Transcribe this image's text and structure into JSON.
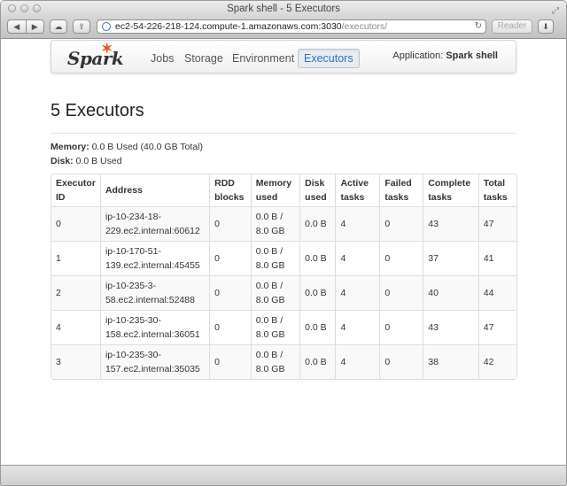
{
  "window": {
    "title": "Spark shell - 5 Executors",
    "url_host": "ec2-54-226-218-124.compute-1.amazonaws.com:3030",
    "url_path": "/executors/",
    "reader_label": "Reader"
  },
  "nav": {
    "logo_text": "Spark",
    "items": [
      {
        "label": "Jobs"
      },
      {
        "label": "Storage"
      },
      {
        "label": "Environment"
      },
      {
        "label": "Executors"
      }
    ],
    "app_label": "Application:",
    "app_name": "Spark shell"
  },
  "page": {
    "heading": "5 Executors",
    "memory_label": "Memory:",
    "memory_value": "0.0 B Used (40.0 GB Total)",
    "disk_label": "Disk:",
    "disk_value": "0.0 B Used"
  },
  "table": {
    "headers": [
      "Executor ID",
      "Address",
      "RDD blocks",
      "Memory used",
      "Disk used",
      "Active tasks",
      "Failed tasks",
      "Complete tasks",
      "Total tasks"
    ],
    "rows": [
      [
        "0",
        "ip-10-234-18-229.ec2.internal:60612",
        "0",
        "0.0 B / 8.0 GB",
        "0.0 B",
        "4",
        "0",
        "43",
        "47"
      ],
      [
        "1",
        "ip-10-170-51-139.ec2.internal:45455",
        "0",
        "0.0 B / 8.0 GB",
        "0.0 B",
        "4",
        "0",
        "37",
        "41"
      ],
      [
        "2",
        "ip-10-235-3-58.ec2.internal:52488",
        "0",
        "0.0 B / 8.0 GB",
        "0.0 B",
        "4",
        "0",
        "40",
        "44"
      ],
      [
        "4",
        "ip-10-235-30-158.ec2.internal:36051",
        "0",
        "0.0 B / 8.0 GB",
        "0.0 B",
        "4",
        "0",
        "43",
        "47"
      ],
      [
        "3",
        "ip-10-235-30-157.ec2.internal:35035",
        "0",
        "0.0 B / 8.0 GB",
        "0.0 B",
        "4",
        "0",
        "38",
        "42"
      ]
    ]
  },
  "colors": {
    "accent": "#2f72b8",
    "logo_star": "#e25a1c"
  }
}
